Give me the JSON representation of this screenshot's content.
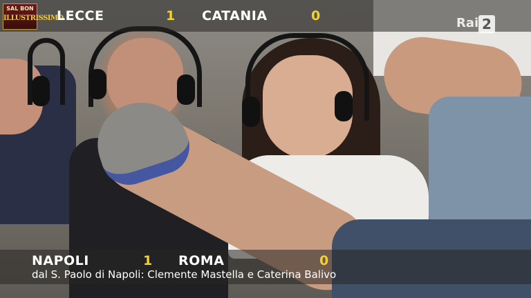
{
  "channel_logo": {
    "top_text": "SAL BON",
    "main_text": "ILLUSTRISSIMO"
  },
  "broadcaster": {
    "name": "Rai",
    "number": "2"
  },
  "top_score": {
    "home_team": "LECCE",
    "home_score": "1",
    "away_team": "CATANIA",
    "away_score": "0"
  },
  "bottom_score": {
    "home_team": "NAPOLI",
    "home_score": "1",
    "away_team": "ROMA",
    "away_score": "0",
    "caption": "dal S. Paolo di Napoli: Clemente Mastella e Caterina Balivo"
  },
  "colors": {
    "score_number": "#f3d22f",
    "overlay": "#282624"
  }
}
